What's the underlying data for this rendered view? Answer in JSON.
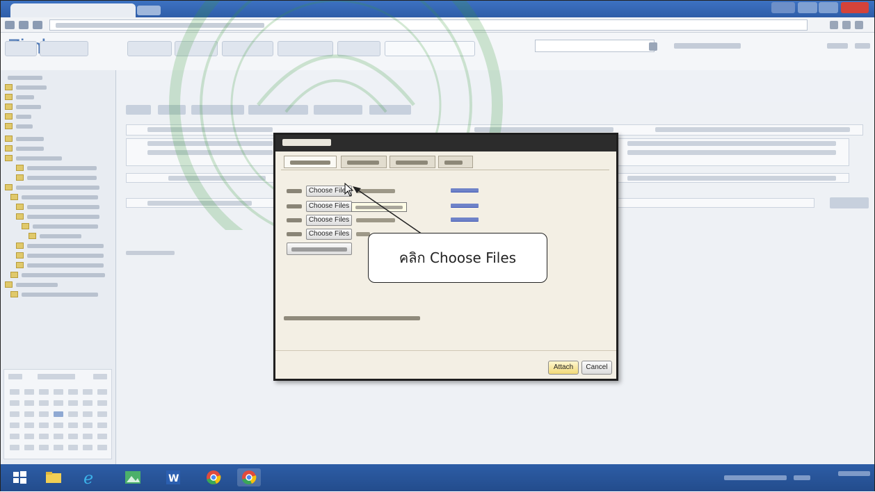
{
  "app": {
    "logo": "Zimbra"
  },
  "attach_dialog": {
    "rows": [
      {
        "button_label": "Choose Files"
      },
      {
        "button_label": "Choose Files"
      },
      {
        "button_label": "Choose Files"
      },
      {
        "button_label": "Choose Files"
      }
    ],
    "attach_label": "Attach",
    "cancel_label": "Cancel"
  },
  "callout": {
    "text": "คลิก Choose Files"
  },
  "colors": {
    "brand": "#4f79b6",
    "dialog_title": "#2c2c2c",
    "dialog_body": "#f3efe4",
    "taskbar": "#2d5da6",
    "close_button": "#d4433a",
    "watermark": "#3c9a3c"
  },
  "icons": {
    "back": "arrow-left-icon",
    "forward": "arrow-right-icon",
    "reload": "refresh-icon",
    "search": "search-icon",
    "windows_start": "windows-logo-icon",
    "file_explorer": "folder-icon",
    "internet_explorer": "ie-icon",
    "word": "word-icon",
    "chrome": "chrome-icon"
  }
}
